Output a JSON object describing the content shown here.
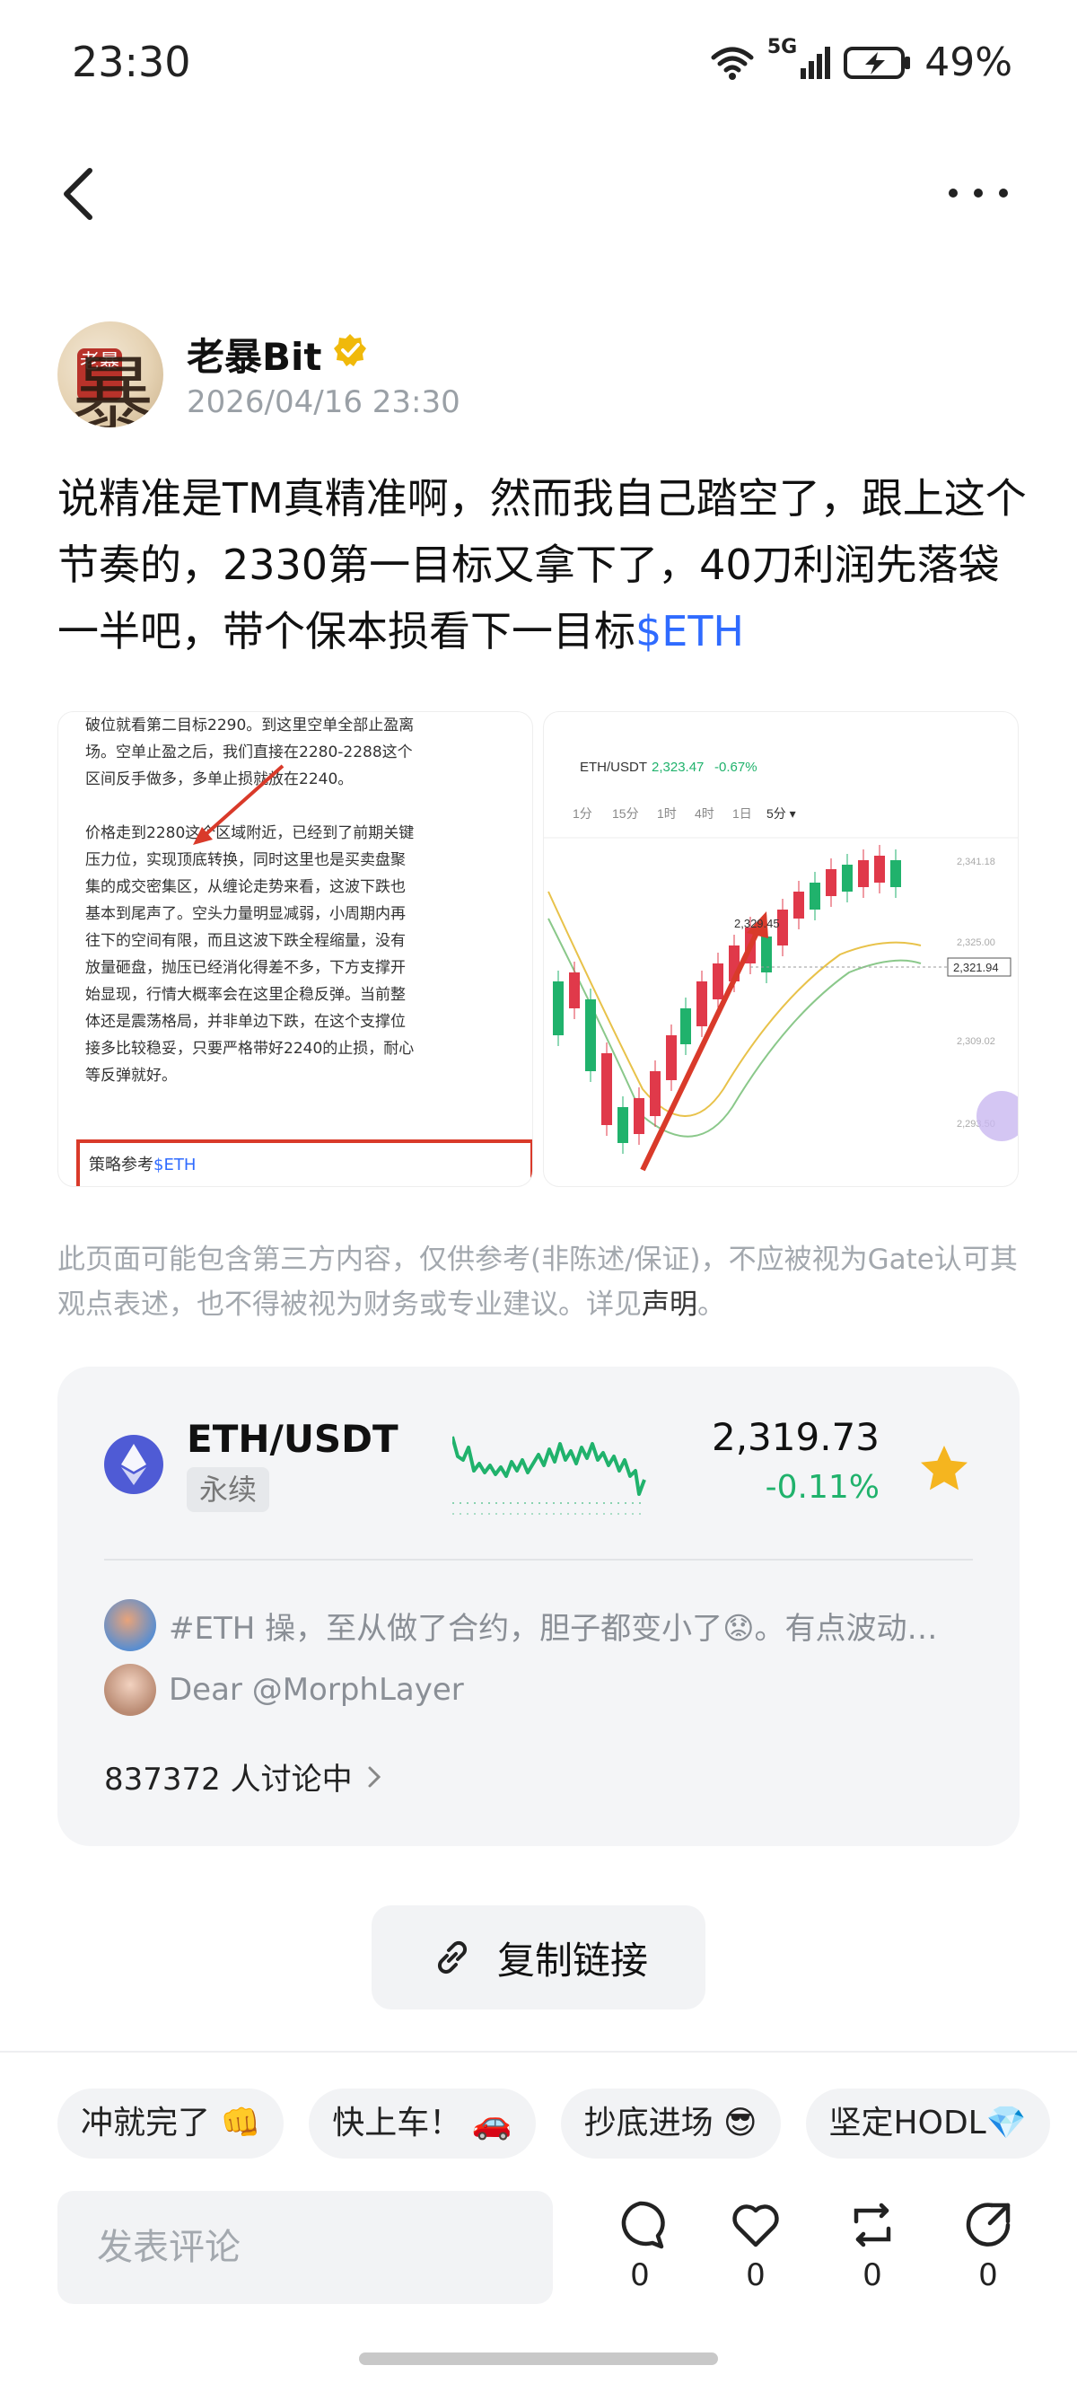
{
  "status_bar": {
    "time": "23:30",
    "network": "5G",
    "battery": "49%"
  },
  "nav": {
    "back_icon": "chevron-left-icon",
    "more_icon": "more-dots-icon"
  },
  "author": {
    "name": "老暴Bit",
    "avatar_text": "老暴",
    "avatar_big": "暴",
    "time": "2026/04/16 23:30",
    "verified_color": "#f0b90b"
  },
  "post": {
    "text": "说精准是TM真精准啊，然而我自己踏空了，跟上这个节奏的，2330第一目标又拿下了，40刀利润先落袋一半吧，带个保本损看下一目标",
    "tag": "$ETH"
  },
  "images": {
    "left_lines": [
      "破位就看第二目标2290。到这里空单全部止盈离",
      "场。空单止盈之后，我们直接在2280-2288这个",
      "区间反手做多，多单止损就放在2240。",
      "",
      "价格走到2280这个区域附近，已经到了前期关键",
      "压力位，实现顶底转换，同时这里也是买卖盘聚",
      "集的成交密集区，从缠论走势来看，这波下跌也",
      "基本到尾声了。空头力量明显减弱，小周期内再",
      "往下的空间有限，而且这波下跌全程缩量，没有",
      "放量砸盘，抛压已经消化得差不多，下方支撑开",
      "始显现，行情大概率会在这里企稳反弹。当前整",
      "体还是震荡格局，并非单边下跌，在这个支撑位",
      "接多比较稳妥，只要严格带好2240的止损，耐心",
      "等反弹就好。"
    ],
    "left_strategy": "策略参考",
    "left_strategy_tag": "$ETH",
    "right_pair": "ETH/USDT",
    "right_price": "2,323.47",
    "right_change": "-0.67%",
    "right_tabs": [
      "1分",
      "15分",
      "1时",
      "4时",
      "1日",
      "5分 ▾"
    ],
    "right_peak": "2,329.45",
    "right_last": "2,321.94",
    "right_levels": [
      "2,341.18",
      "2,325.00",
      "2,309.02",
      "2,293.50"
    ]
  },
  "disclaimer": {
    "text": "此页面可能包含第三方内容，仅供参考(非陈述/保证)，不应被视为Gate认可其观点表述，也不得被视为财务或专业建议。详见",
    "link": "声明",
    "end": "。"
  },
  "market": {
    "pair": "ETH/USDT",
    "badge": "永续",
    "price": "2,319.73",
    "change": "-0.11%",
    "up_color": "#20b26c",
    "comments": [
      {
        "text": "#ETH 操，至从做了合约，胆子都变小了😟。有点波动…"
      },
      {
        "text": "Dear @MorphLayer"
      }
    ],
    "discussing": "837372 人讨论中"
  },
  "copy_link": {
    "label": "复制链接"
  },
  "reactions": [
    "冲就完了 👊",
    "快上车！ 🚗",
    "抄底进场 😎",
    "坚定HODL💎"
  ],
  "comment_bar": {
    "placeholder": "发表评论",
    "comment_count": "0",
    "like_count": "0",
    "repost_count": "0",
    "share_count": "0"
  }
}
